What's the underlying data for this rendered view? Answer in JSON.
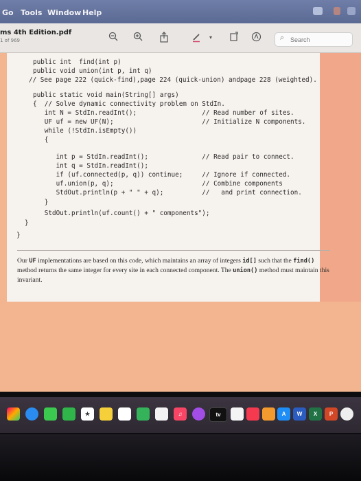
{
  "menu": {
    "items": [
      "Go",
      "Tools",
      "Window",
      "Help"
    ]
  },
  "toolbar": {
    "doc_title": "ms 4th Edition.pdf",
    "page_info": "1 of 969",
    "search_placeholder": "Search",
    "icons": [
      "zoom-out-icon",
      "zoom-in-icon",
      "share-icon",
      "highlight-pen-icon",
      "chevron-down-icon",
      "rotate-icon",
      "markup-icon",
      "search-icon"
    ]
  },
  "document": {
    "code_lines": [
      "public int  find(int p)",
      "public void union(int p, int q)",
      "// See page 222 (quick-find),page 224 (quick-union) andpage 228 (weighted).",
      "",
      "public static void main(String[] args)",
      "{  // Solve dynamic connectivity problem on StdIn.",
      "   int N = StdIn.readInt();                 // Read number of sites.",
      "   UF uf = new UF(N);                       // Initialize N components.",
      "   while (!StdIn.isEmpty())",
      "   {",
      "      int p = StdIn.readInt();              // Read pair to connect.",
      "      int q = StdIn.readInt();",
      "      if (uf.connected(p, q)) continue;     // Ignore if connected.",
      "      uf.union(p, q);                       // Combine components",
      "      StdOut.println(p + \" \" + q);          //   and print connection.",
      "   }",
      "   StdOut.println(uf.count() + \" components\");",
      "}"
    ],
    "closing_brace": "}",
    "prose": {
      "part1": "Our ",
      "uf": "UF",
      "part2": " implementations are based on this code, which maintains an array of integers ",
      "id": "id[]",
      "part3": " such that the ",
      "find": "find()",
      "part4": " method returns the same integer for every site in each connected component. The ",
      "union": "union()",
      "part5": " method must maintain this invariant."
    }
  },
  "dock": {
    "apps": [
      "Launchpad",
      "Safari",
      "Messages",
      "FaceTime",
      "Photos",
      "Notes",
      "Reminders",
      "Numbers",
      "Keynote",
      "Music",
      "Podcasts",
      "Apple TV",
      "Freeform",
      "News",
      "Books",
      "App Store",
      "Word",
      "Excel",
      "PowerPoint",
      "Chrome"
    ],
    "tv_label": "tv",
    "word_label": "W",
    "excel_label": "X",
    "ppt_label": "P"
  }
}
